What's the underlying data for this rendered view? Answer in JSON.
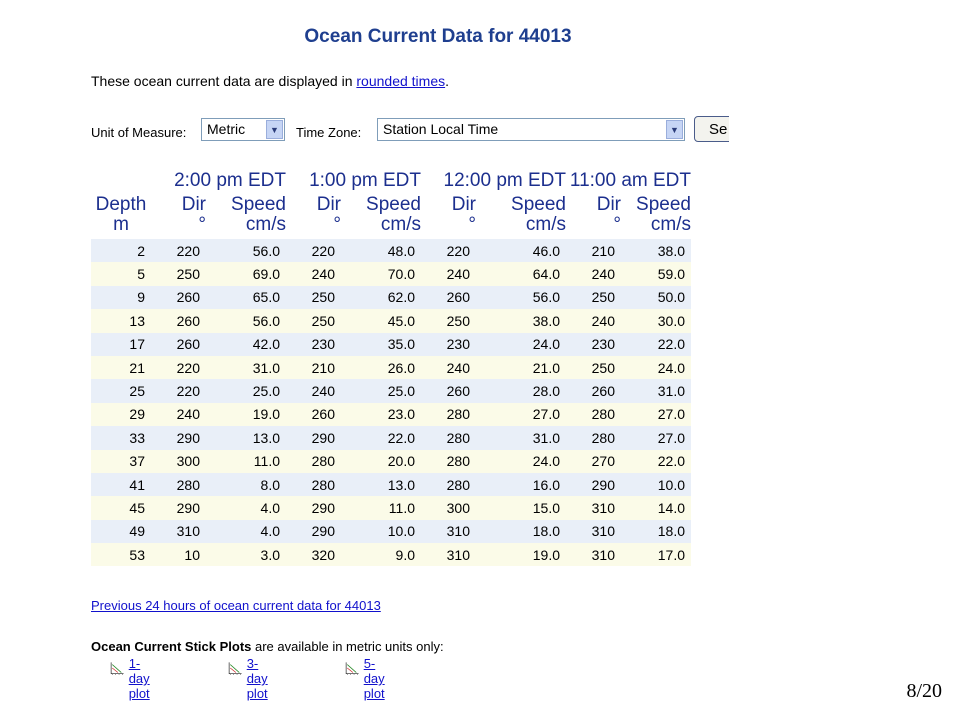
{
  "title": "Ocean Current Data for 44013",
  "intro": {
    "text": "These ocean current data are displayed in ",
    "link": "rounded times",
    "end": "."
  },
  "controls": {
    "unit_label": "Unit of Measure:",
    "unit_value": "Metric",
    "tz_label": "Time Zone:",
    "tz_value": "Station Local Time",
    "button_label": "Se"
  },
  "table": {
    "times": [
      "2:00 pm EDT",
      "1:00 pm EDT",
      "12:00 pm EDT",
      "11:00 am EDT"
    ],
    "depth_header": [
      "Depth",
      "m"
    ],
    "dir_header": [
      "Dir",
      "°"
    ],
    "speed_header": [
      "Speed",
      "cm/s"
    ],
    "rows": [
      [
        "2",
        "220",
        "56.0",
        "220",
        "48.0",
        "220",
        "46.0",
        "210",
        "38.0"
      ],
      [
        "5",
        "250",
        "69.0",
        "240",
        "70.0",
        "240",
        "64.0",
        "240",
        "59.0"
      ],
      [
        "9",
        "260",
        "65.0",
        "250",
        "62.0",
        "260",
        "56.0",
        "250",
        "50.0"
      ],
      [
        "13",
        "260",
        "56.0",
        "250",
        "45.0",
        "250",
        "38.0",
        "240",
        "30.0"
      ],
      [
        "17",
        "260",
        "42.0",
        "230",
        "35.0",
        "230",
        "24.0",
        "230",
        "22.0"
      ],
      [
        "21",
        "220",
        "31.0",
        "210",
        "26.0",
        "240",
        "21.0",
        "250",
        "24.0"
      ],
      [
        "25",
        "220",
        "25.0",
        "240",
        "25.0",
        "260",
        "28.0",
        "260",
        "31.0"
      ],
      [
        "29",
        "240",
        "19.0",
        "260",
        "23.0",
        "280",
        "27.0",
        "280",
        "27.0"
      ],
      [
        "33",
        "290",
        "13.0",
        "290",
        "22.0",
        "280",
        "31.0",
        "280",
        "27.0"
      ],
      [
        "37",
        "300",
        "11.0",
        "280",
        "20.0",
        "280",
        "24.0",
        "270",
        "22.0"
      ],
      [
        "41",
        "280",
        "8.0",
        "280",
        "13.0",
        "280",
        "16.0",
        "290",
        "10.0"
      ],
      [
        "45",
        "290",
        "4.0",
        "290",
        "11.0",
        "300",
        "15.0",
        "310",
        "14.0"
      ],
      [
        "49",
        "310",
        "4.0",
        "290",
        "10.0",
        "310",
        "18.0",
        "310",
        "18.0"
      ],
      [
        "53",
        "10",
        "3.0",
        "320",
        "9.0",
        "310",
        "19.0",
        "310",
        "17.0"
      ]
    ]
  },
  "prev_link": "Previous 24 hours of ocean current data for 44013",
  "stick": {
    "bold": "Ocean Current Stick Plots",
    "rest": " are available in metric units only:",
    "plots": [
      "1-day plot",
      "3-day plot",
      "5-day plot"
    ]
  },
  "page_number": "8/20",
  "colors": {
    "title": "#1f3f8f",
    "header": "#1c2f8e",
    "row_odd": "#e9eff8",
    "row_even": "#fbfbe8",
    "link": "#1111cc"
  },
  "icons": {
    "plot": "stick-plot-icon",
    "dropdown": "chevron-down-icon"
  }
}
